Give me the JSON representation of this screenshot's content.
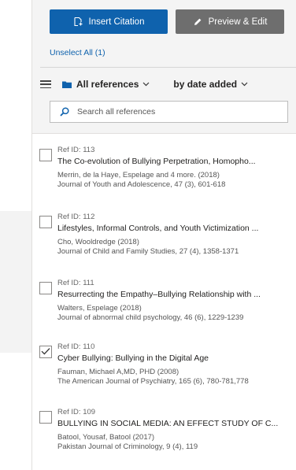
{
  "toolbar": {
    "insert_label": "Insert Citation",
    "preview_label": "Preview & Edit",
    "unselect_label": "Unselect All (1)"
  },
  "filters": {
    "collection": "All references",
    "sort": "by date added"
  },
  "search": {
    "placeholder": "Search all references",
    "value": ""
  },
  "references": [
    {
      "ref_id": "Ref ID: 113",
      "title": "The Co-evolution of Bullying Perpetration, Homopho...",
      "authors": "Merrin, de la Haye, Espelage and 4 more. (2018)",
      "journal": "Journal of Youth and Adolescence, 47 (3), 601-618",
      "checked": false
    },
    {
      "ref_id": "Ref ID: 112",
      "title": "Lifestyles, Informal Controls, and Youth Victimization ...",
      "authors": "Cho, Wooldredge (2018)",
      "journal": "Journal of Child and Family Studies, 27 (4), 1358-1371",
      "checked": false
    },
    {
      "ref_id": "Ref ID: 111",
      "title": "Resurrecting the Empathy–Bullying Relationship with ...",
      "authors": "Walters, Espelage (2018)",
      "journal": "Journal of abnormal child psychology, 46 (6), 1229-1239",
      "checked": false
    },
    {
      "ref_id": "Ref ID: 110",
      "title": "Cyber Bullying: Bullying in the Digital Age",
      "authors": "Fauman, Michael A,MD, PHD (2008)",
      "journal": "The American Journal of Psychiatry, 165 (6), 780-781,778",
      "checked": true
    },
    {
      "ref_id": "Ref ID: 109",
      "title": "BULLYING IN SOCIAL MEDIA: AN EFFECT STUDY OF C...",
      "authors": "Batool, Yousaf, Batool (2017)",
      "journal": "Pakistan Journal of Criminology, 9 (4), 119",
      "checked": false
    }
  ],
  "colors": {
    "accent": "#0f62ad",
    "secondary_button": "#6e6e6e",
    "toolbar_bg": "#f4f4f4"
  }
}
